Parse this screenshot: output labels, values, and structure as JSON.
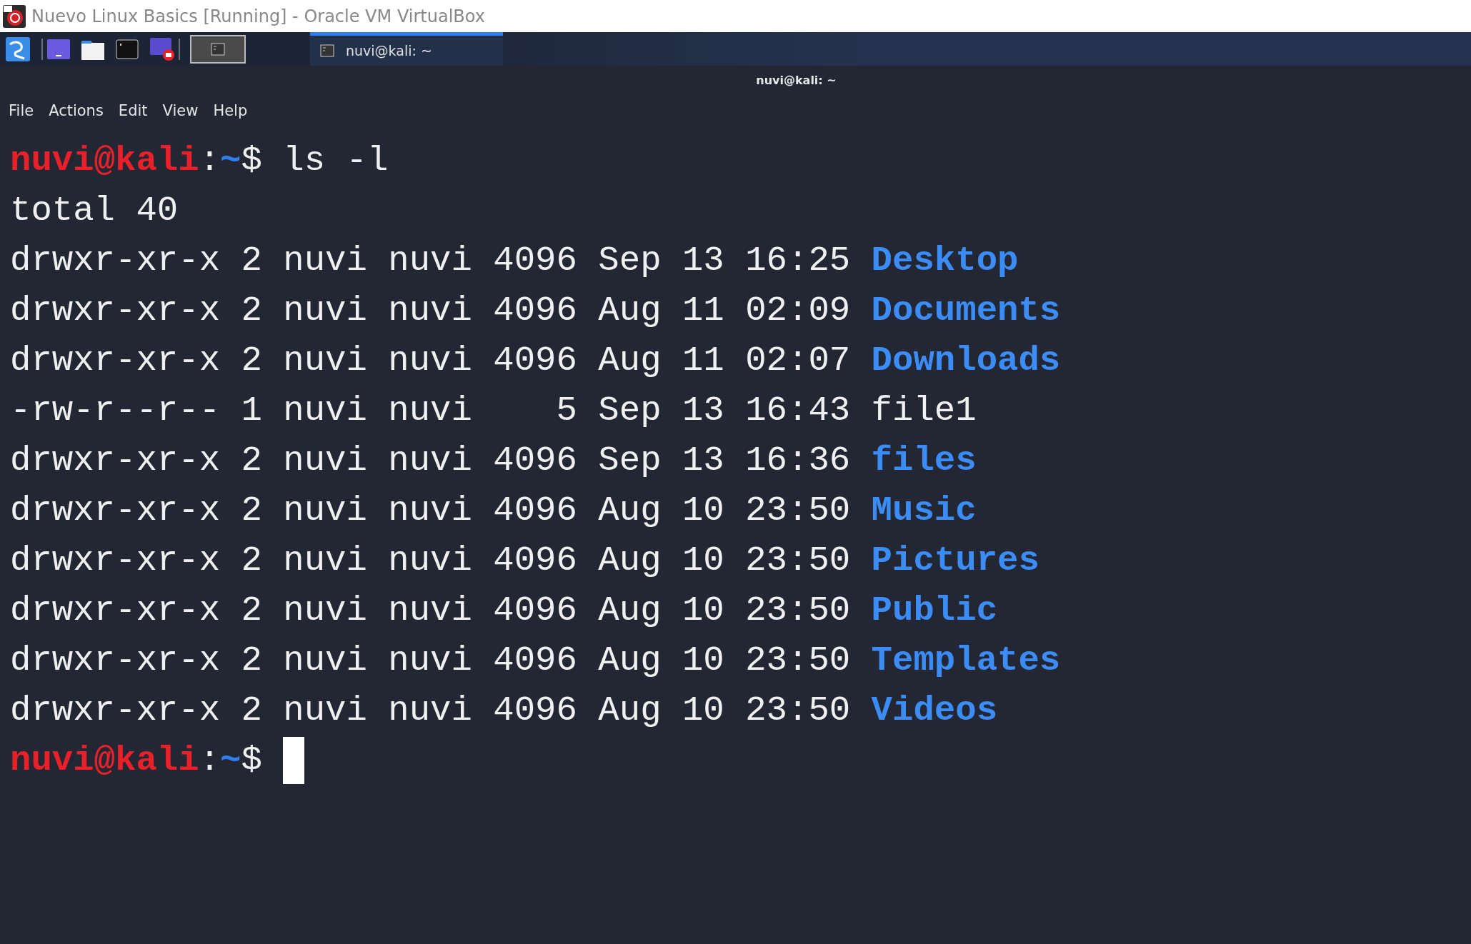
{
  "window": {
    "title": "Nuevo Linux Basics [Running] - Oracle VM VirtualBox"
  },
  "taskbar": {
    "workspace": {
      "selected": true
    },
    "tasks": [
      {
        "label": "nuvi@kali: ~",
        "selected": true
      }
    ]
  },
  "terminal": {
    "title": "nuvi@kali: ~",
    "menu": [
      "File",
      "Actions",
      "Edit",
      "View",
      "Help"
    ],
    "lines": [
      {
        "kind": "prompt",
        "user": "nuvi@kali",
        "sep": ":",
        "path": "~",
        "symbol": "$",
        "command": "ls -l"
      },
      {
        "kind": "output",
        "text": "total 40"
      },
      {
        "kind": "entry",
        "info": "drwxr-xr-x 2 nuvi nuvi 4096 Sep 13 16:25",
        "name": "Desktop",
        "directory": true
      },
      {
        "kind": "entry",
        "info": "drwxr-xr-x 2 nuvi nuvi 4096 Aug 11 02:09",
        "name": "Documents",
        "directory": true
      },
      {
        "kind": "entry",
        "info": "drwxr-xr-x 2 nuvi nuvi 4096 Aug 11 02:07",
        "name": "Downloads",
        "directory": true
      },
      {
        "kind": "entry",
        "info": "-rw-r--r-- 1 nuvi nuvi    5 Sep 13 16:43",
        "name": "file1",
        "directory": false
      },
      {
        "kind": "entry",
        "info": "drwxr-xr-x 2 nuvi nuvi 4096 Sep 13 16:36",
        "name": "files",
        "directory": true
      },
      {
        "kind": "entry",
        "info": "drwxr-xr-x 2 nuvi nuvi 4096 Aug 10 23:50",
        "name": "Music",
        "directory": true
      },
      {
        "kind": "entry",
        "info": "drwxr-xr-x 2 nuvi nuvi 4096 Aug 10 23:50",
        "name": "Pictures",
        "directory": true
      },
      {
        "kind": "entry",
        "info": "drwxr-xr-x 2 nuvi nuvi 4096 Aug 10 23:50",
        "name": "Public",
        "directory": true
      },
      {
        "kind": "entry",
        "info": "drwxr-xr-x 2 nuvi nuvi 4096 Aug 10 23:50",
        "name": "Templates",
        "directory": true
      },
      {
        "kind": "entry",
        "info": "drwxr-xr-x 2 nuvi nuvi 4096 Aug 10 23:50",
        "name": "Videos",
        "directory": true
      },
      {
        "kind": "prompt",
        "user": "nuvi@kali",
        "sep": ":",
        "path": "~",
        "symbol": "$",
        "cursor": true
      }
    ]
  }
}
